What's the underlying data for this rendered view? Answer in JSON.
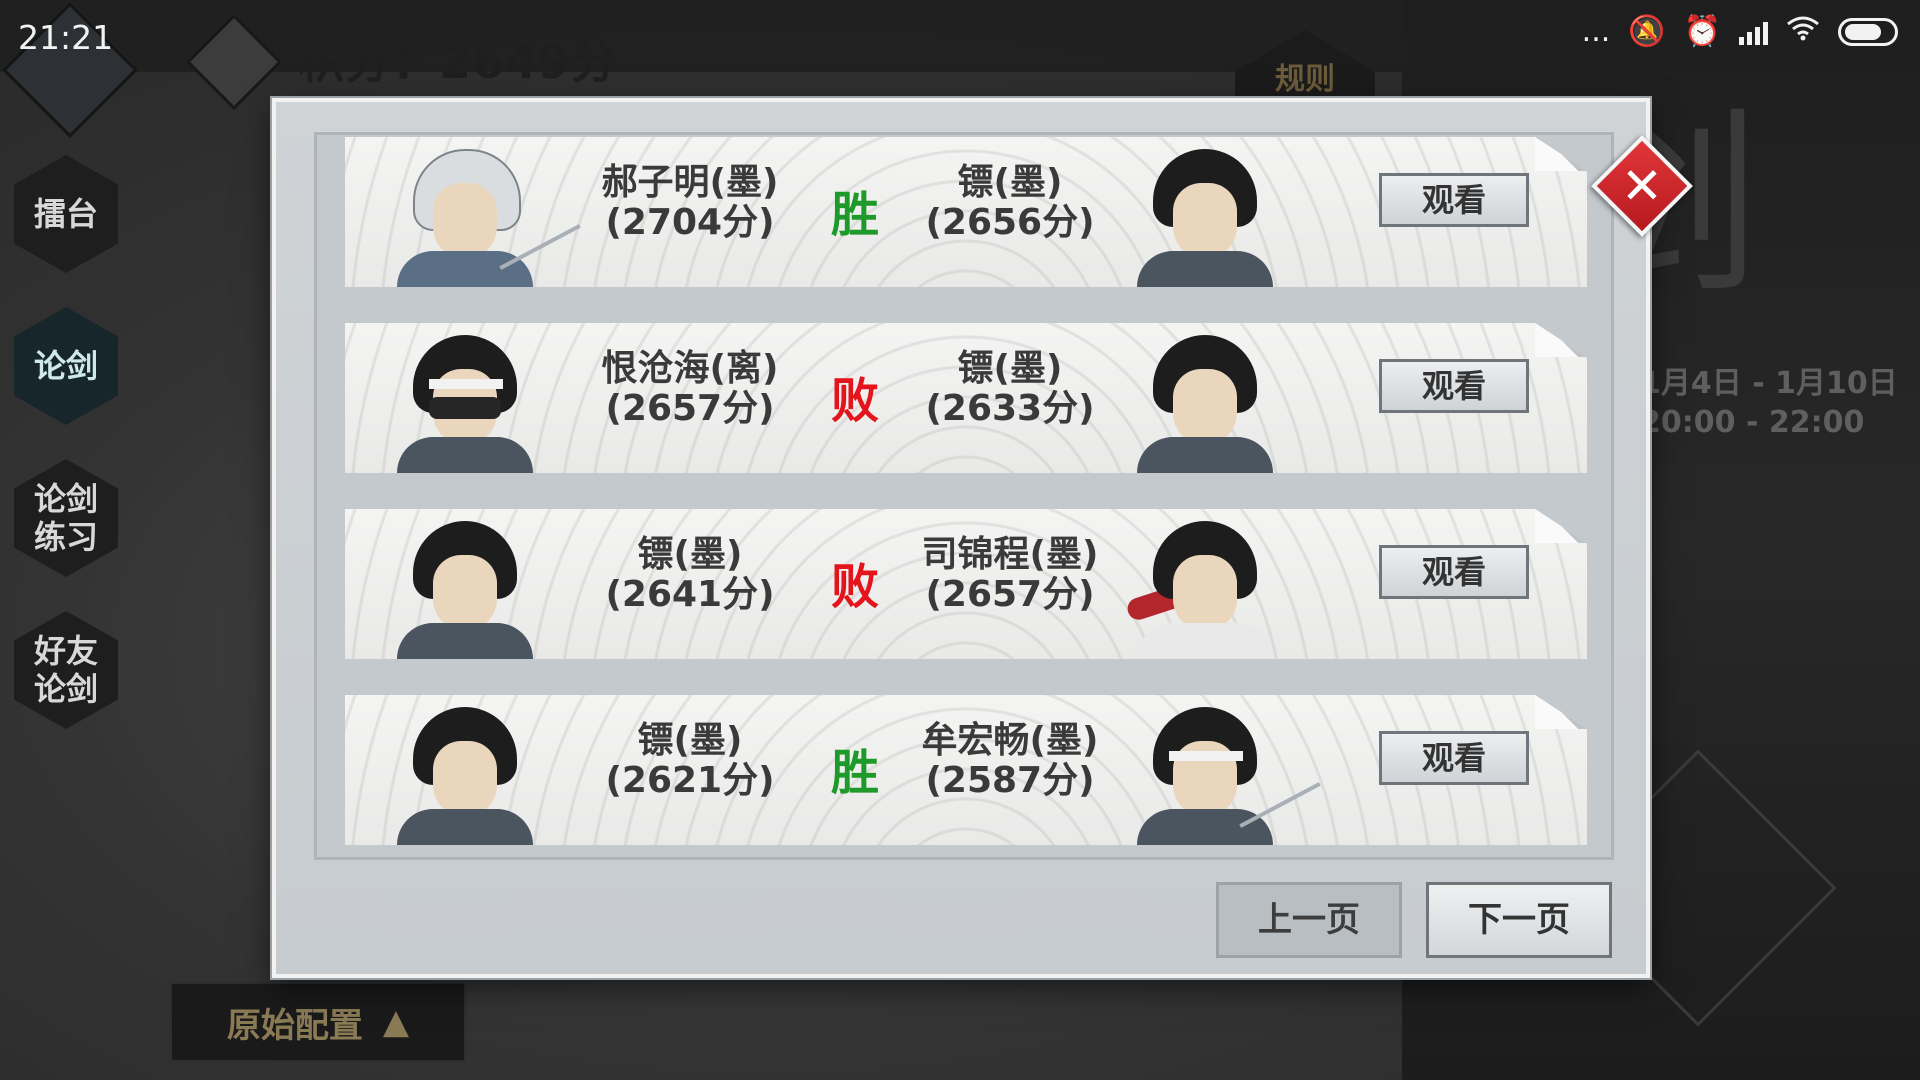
{
  "status_bar": {
    "time": "21:21",
    "dots": "...",
    "mute_icon": "mute-bell-icon",
    "alarm_icon": "alarm-icon",
    "signal_icon": "signal-icon",
    "wifi_icon": "wifi-icon",
    "battery_icon": "battery-icon"
  },
  "header": {
    "score_text": "积分：2649分",
    "rules_label": "规则"
  },
  "side_nav": [
    {
      "label": "擂台",
      "active": false
    },
    {
      "label": "论剑",
      "active": true
    },
    {
      "label": "论剑\n练习",
      "active": false
    },
    {
      "label": "好友\n论剑",
      "active": false
    }
  ],
  "background": {
    "date_range": "1月4日 - 1月10日",
    "time_range": "20:00 - 22:00",
    "preset_label": "原始配置"
  },
  "records": [
    {
      "left_name": "郝子明(墨)",
      "left_score": "(2704分)",
      "result": "胜",
      "result_type": "win",
      "right_name": "镖(墨)",
      "right_score": "(2656分)",
      "watch_label": "观看",
      "left_avatar": "white-hood",
      "right_avatar": "long-hair"
    },
    {
      "left_name": "恨沧海(离)",
      "left_score": "(2657分)",
      "result": "败",
      "result_type": "lose",
      "right_name": "镖(墨)",
      "right_score": "(2633分)",
      "watch_label": "观看",
      "left_avatar": "masked",
      "right_avatar": "long-hair"
    },
    {
      "left_name": "镖(墨)",
      "left_score": "(2641分)",
      "result": "败",
      "result_type": "lose",
      "right_name": "司锦程(墨)",
      "right_score": "(2657分)",
      "watch_label": "观看",
      "left_avatar": "long-hair",
      "right_avatar": "red-scarf"
    },
    {
      "left_name": "镖(墨)",
      "left_score": "(2621分)",
      "result": "胜",
      "result_type": "win",
      "right_name": "牟宏畅(墨)",
      "right_score": "(2587分)",
      "watch_label": "观看",
      "left_avatar": "long-hair",
      "right_avatar": "band-head"
    }
  ],
  "pagination": {
    "prev_label": "上一页",
    "next_label": "下一页"
  },
  "colors": {
    "win": "#1e9a2a",
    "lose": "#e3141b",
    "close_button": "#d02a2f"
  }
}
